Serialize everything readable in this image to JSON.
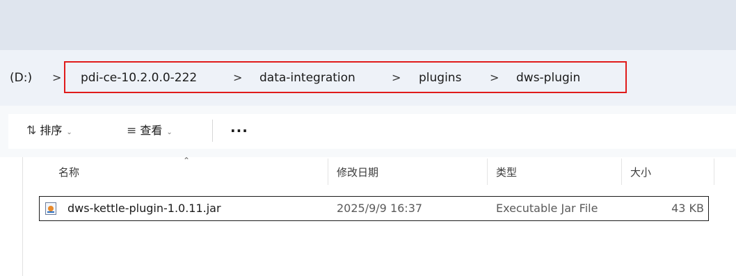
{
  "address_bar": {
    "root": "(D:)",
    "segments": [
      "pdi-ce-10.2.0.0-222",
      "data-integration",
      "plugins",
      "dws-plugin"
    ],
    "separator": ">"
  },
  "toolbar": {
    "sort_label": "排序",
    "view_label": "查看",
    "more_label": "···"
  },
  "columns": {
    "name": "名称",
    "modified": "修改日期",
    "type": "类型",
    "size": "大小"
  },
  "files": [
    {
      "name": "dws-kettle-plugin-1.0.11.jar",
      "modified": "2025/9/9 16:37",
      "type": "Executable Jar File",
      "size": "43 KB"
    }
  ],
  "colors": {
    "highlight": "#e01b1b",
    "address_bg": "#eef2f8"
  }
}
